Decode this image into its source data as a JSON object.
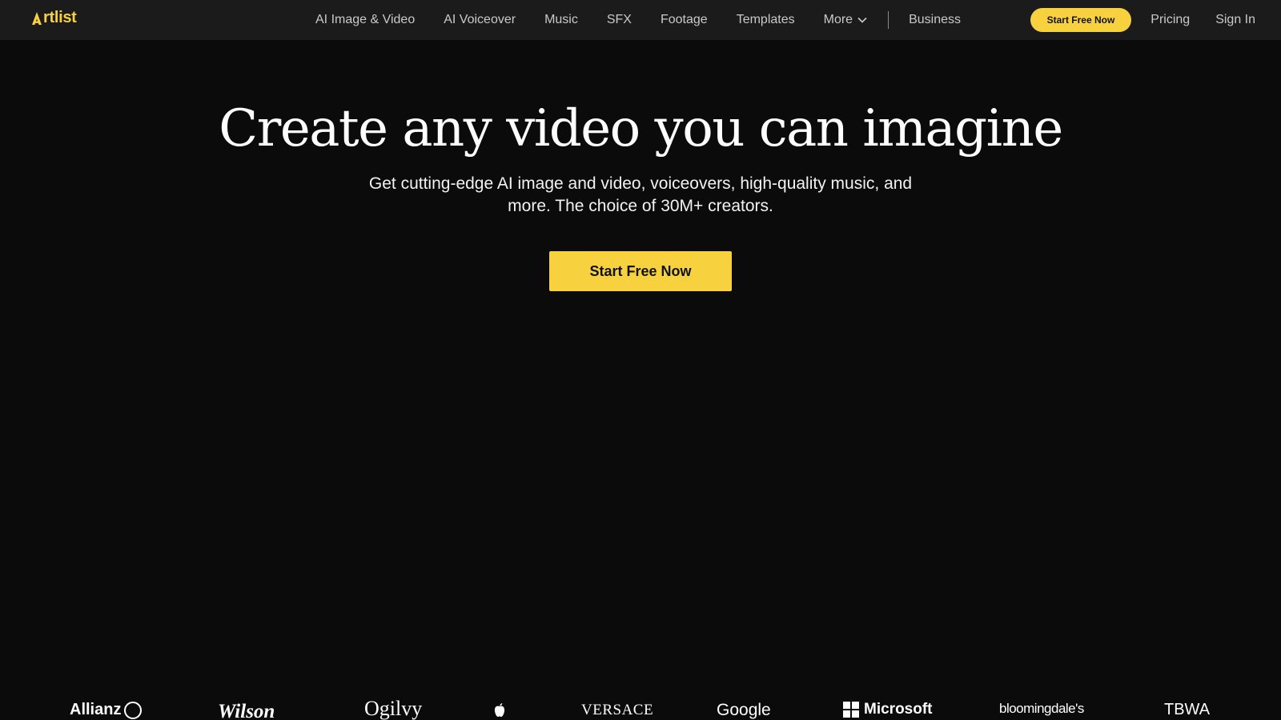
{
  "nav": {
    "logo_text": "rtlist",
    "links": [
      "AI Image & Video",
      "AI Voiceover",
      "Music",
      "SFX",
      "Footage",
      "Templates"
    ],
    "more_label": "More",
    "business_label": "Business",
    "cta_label": "Start Free Now",
    "pricing_label": "Pricing",
    "signin_label": "Sign In"
  },
  "hero": {
    "title": "Create any video you can imagine",
    "subtitle": "Get cutting-edge AI image and video, voiceovers, high-quality music, and more. The choice of 30M+ creators.",
    "cta_label": "Start Free Now"
  },
  "brands": {
    "allianz": "Allianz",
    "wilson": "Wilson",
    "ogilvy": "Ogilvy",
    "versace": "VERSACE",
    "google": "Google",
    "microsoft": "Microsoft",
    "bloomingdales": "bloomingdale's",
    "tbwa": "TBWA"
  },
  "colors": {
    "accent": "#f7d23e",
    "background": "#0b0b0c",
    "nav_background": "#1b1b1c"
  }
}
